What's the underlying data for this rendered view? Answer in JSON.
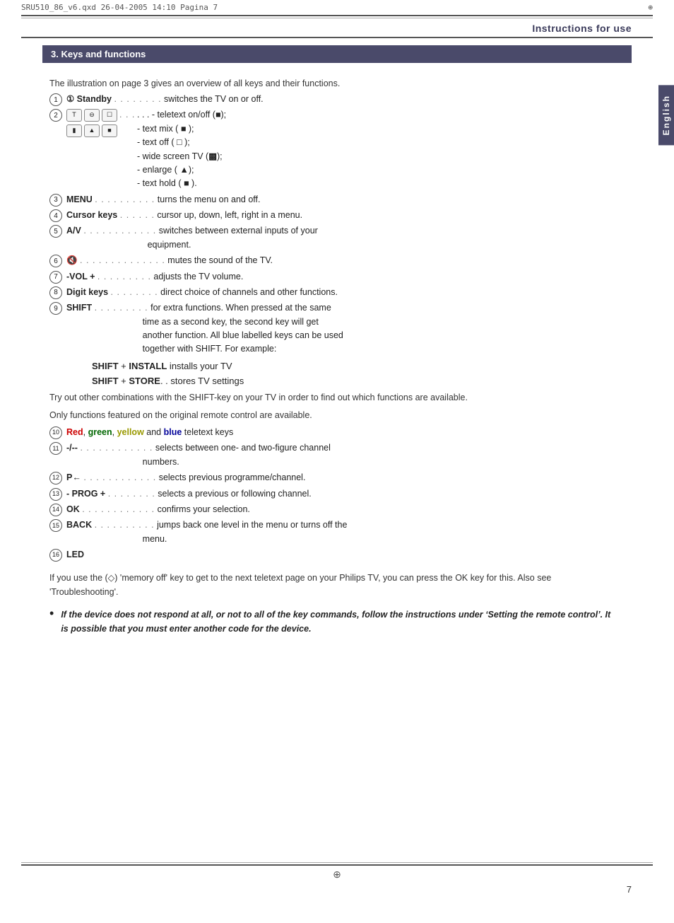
{
  "header": {
    "file_info": "SRU510_86_v6.qxd  26-04-2005  14:10  Pagina 7"
  },
  "instructions_label": "Instructions for use",
  "side_tab": "English",
  "section_title": "3. Keys and functions",
  "intro": "The illustration on page 3 gives an overview of all keys and their functions.",
  "items": [
    {
      "num": "1",
      "content_html": "<b>&#9317; Standby</b> <span class='dots'>. . . . . . . .</span> switches the TV on or off."
    },
    {
      "num": "2",
      "has_icons": true
    },
    {
      "num": "3",
      "content_html": "<b>MENU</b> <span class='dots'>. . . . . . . . . .</span> turns the menu on and off."
    },
    {
      "num": "4",
      "content_html": "<b>Cursor keys</b> <span class='dots'>. . . . . .</span> cursor up, down, left, right in a menu."
    },
    {
      "num": "5",
      "content_html": "<b>A/V</b> <span class='dots'>. . . . . . . . . . . .</span> switches between external inputs of your equipment."
    },
    {
      "num": "6",
      "content_html": "&#x1F507; <span class='dots'>. . . . . . . . . . . . . .</span> mutes the sound of the TV."
    },
    {
      "num": "7",
      "content_html": "<b>-VOL +</b> <span class='dots'>. . . . . . . . .</span> adjusts the TV volume."
    },
    {
      "num": "8",
      "content_html": "<b>Digit keys</b> <span class='dots'>. . . . . . . .</span> direct choice of channels and other functions."
    },
    {
      "num": "9",
      "content_html": "<b>SHIFT</b> <span class='dots'>. . . . . . . . .</span> for extra functions. When pressed at the same time as a second key, the second key will get another function. All blue labelled keys can be used together with SHIFT. For example:"
    }
  ],
  "shift_lines": [
    "<b>SHIFT</b> + <b>INSTALL</b> installs your TV",
    "<b>SHIFT</b> + <b>STORE</b> . . stores TV settings"
  ],
  "paragraphs": [
    "Try out other combinations with the SHIFT-key on your TV in order to find out which functions are available.",
    "Only functions featured on the original remote control are available."
  ],
  "item_10": {
    "num": "10",
    "content_html": "<span style='color:#cc0000;font-weight:bold'>Red</span>, <span style='color:#006600;font-weight:bold'>green</span>, <span style='color:#999900;font-weight:bold'>yellow</span> and <span style='color:#000099;font-weight:bold'>blue</span> teletext keys"
  },
  "items_11_16": [
    {
      "num": "11",
      "content_html": "<b>-/--</b> <span class='dots'>. . . . . . . . . . . .</span> selects between one- and two-figure channel numbers."
    },
    {
      "num": "12",
      "content_html": "<b>P&#x2190;</b> <span class='dots'>. . . . . . . . . . . .</span> selects previous programme/channel."
    },
    {
      "num": "13",
      "content_html": "<b>- PROG +</b> <span class='dots'>. . . . . . . .</span> selects a previous or following channel."
    },
    {
      "num": "14",
      "content_html": "<b>OK</b> <span class='dots'>. . . . . . . . . . . .</span> confirms your selection."
    },
    {
      "num": "15",
      "content_html": "<b>BACK</b> <span class='dots'>. . . . . . . . . .</span> jumps back one level in the menu or turns off the menu."
    },
    {
      "num": "16",
      "content_html": "<b>LED</b>"
    }
  ],
  "memory_note": "If you use the (♢) ‘memory off’ key to get to the next teletext page on your Philips TV, you can press the OK key for this. Also see ‘Troubleshooting’.",
  "bullet_note": "If the device does not respond at all, or not to all of the key commands, follow the instructions under ‘Setting the remote control’. It is possible that you must enter another code for the device.",
  "page_number": "7",
  "teletext_items": [
    "teletext on/off (■);",
    "- text mix (■);",
    "- text off (□);",
    "- wide screen TV (■);",
    "- enlarge (■);",
    "- text hold (■)."
  ]
}
